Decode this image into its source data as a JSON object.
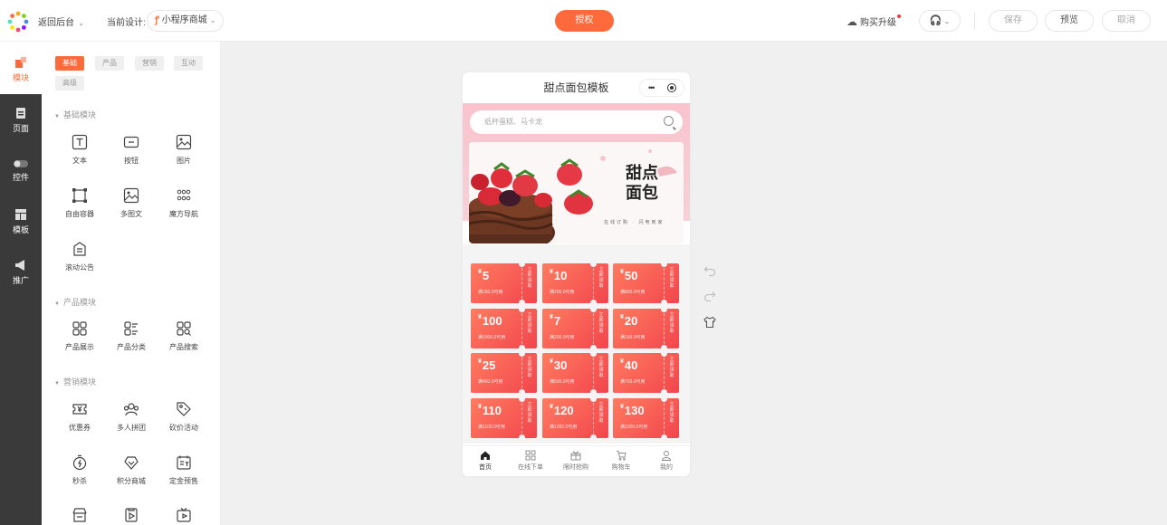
{
  "header": {
    "back_label": "返回后台",
    "current_design_label": "当前设计:",
    "current_design_value": "小程序商城",
    "auth_label": "授权",
    "upgrade_label": "购买升级",
    "save_label": "保存",
    "preview_label": "预览",
    "cancel_label": "取消"
  },
  "rail": {
    "items": [
      {
        "label": "模块",
        "icon": "module-icon"
      },
      {
        "label": "页面",
        "icon": "page-icon"
      },
      {
        "label": "控件",
        "icon": "toggle-icon"
      },
      {
        "label": "模板",
        "icon": "template-icon"
      },
      {
        "label": "推广",
        "icon": "megaphone-icon"
      }
    ]
  },
  "panel": {
    "tabs": [
      "基础",
      "产品",
      "营销",
      "互动",
      "高级"
    ],
    "sections": [
      {
        "title": "基础模块",
        "items": [
          "文本",
          "按钮",
          "图片",
          "自由容器",
          "多图文",
          "魔方导航",
          "滚动公告"
        ]
      },
      {
        "title": "产品模块",
        "items": [
          "产品展示",
          "产品分类",
          "产品搜索"
        ]
      },
      {
        "title": "营销模块",
        "items": [
          "优惠券",
          "多人拼团",
          "砍价活动",
          "秒杀",
          "积分商城",
          "定金预售"
        ]
      }
    ]
  },
  "phone": {
    "title": "甜点面包模板",
    "capsule_dots": "•••",
    "search_placeholder": "纸杯蛋糕、马卡龙",
    "banner": {
      "title_line1": "甜点",
      "title_line2": "面包",
      "subtitle": "在线订购 · 闪电到家"
    },
    "coupons": [
      {
        "amount": "5",
        "condition": "满150.0可用"
      },
      {
        "amount": "10",
        "condition": "满200.0可用"
      },
      {
        "amount": "50",
        "condition": "满800.0可用"
      },
      {
        "amount": "100",
        "condition": "满1000.0可用"
      },
      {
        "amount": "7",
        "condition": "满200.0可用"
      },
      {
        "amount": "20",
        "condition": "满150.0可用"
      },
      {
        "amount": "25",
        "condition": "满400.0可用"
      },
      {
        "amount": "30",
        "condition": "满500.0可用"
      },
      {
        "amount": "40",
        "condition": "满700.0可用"
      },
      {
        "amount": "110",
        "condition": "满1100.0可用"
      },
      {
        "amount": "120",
        "condition": "满1200.0可用"
      },
      {
        "amount": "130",
        "condition": "满1300.0可用"
      }
    ],
    "coupon_currency": "¥",
    "coupon_get_label": "立即领取",
    "tabbar": [
      "首页",
      "在线下单",
      "限时抢购",
      "购物车",
      "我的"
    ]
  },
  "colors": {
    "accent": "#ff6a3d",
    "coupon_start": "#ff7b5f",
    "coupon_end": "#f2454d",
    "rail_bg": "#3a3a3a"
  }
}
